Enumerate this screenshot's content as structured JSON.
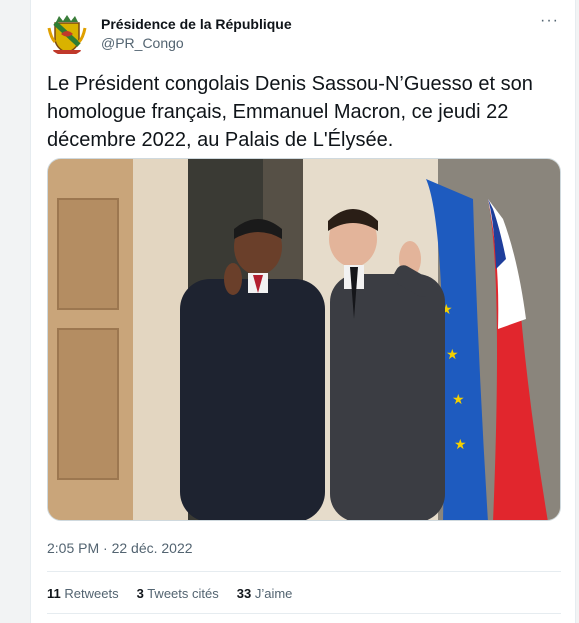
{
  "tweet": {
    "display_name": "Présidence de la République",
    "handle": "@PR_Congo",
    "more_label": "···",
    "text": "Le Président congolais Denis Sassou-N’Guesso et son homologue français, Emmanuel Macron, ce jeudi 22 décembre 2022, au Palais de L'Élysée.",
    "timestamp": "2:05 PM · 22 déc. 2022",
    "stats": [
      {
        "count": "11",
        "label": "Retweets"
      },
      {
        "count": "3",
        "label": "Tweets cités"
      },
      {
        "count": "33",
        "label": "J’aime"
      }
    ]
  },
  "icons": {
    "avatar": "coat-of-arms-icon",
    "more": "more-options-icon"
  },
  "colors": {
    "text_primary": "#0f1419",
    "text_secondary": "#536471",
    "border": "#e6ecf0"
  }
}
